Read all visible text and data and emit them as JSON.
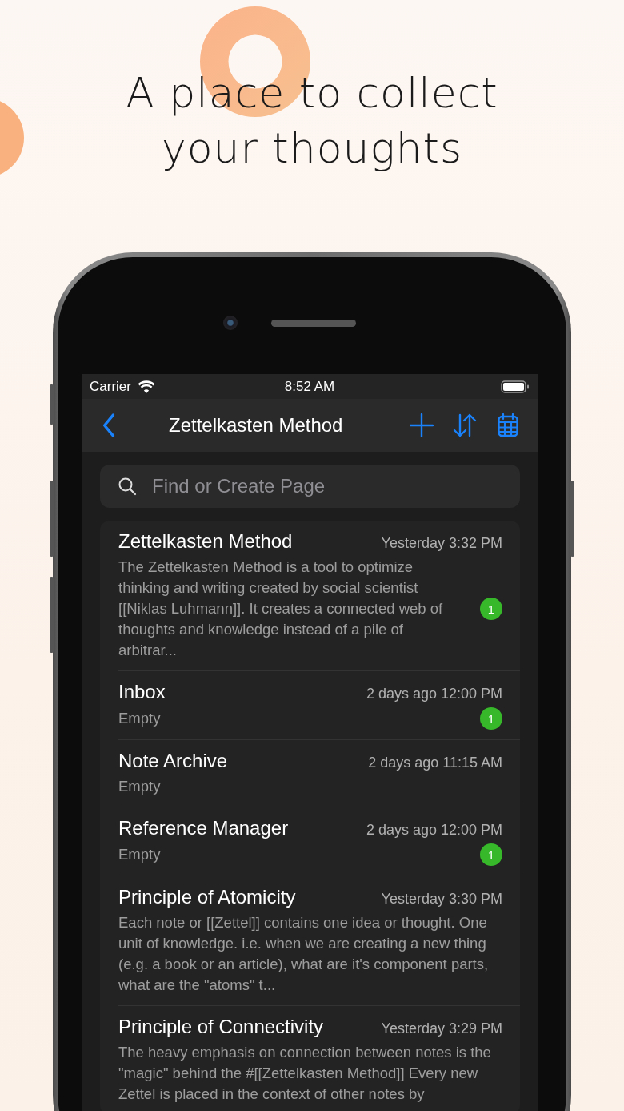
{
  "headline": "A place to collect your thoughts",
  "status_bar": {
    "carrier": "Carrier",
    "time": "8:52 AM"
  },
  "nav_bar": {
    "title": "Zettelkasten Method"
  },
  "search": {
    "placeholder": "Find or Create Page"
  },
  "notes": [
    {
      "title": "Zettelkasten Method",
      "time": "Yesterday 3:32 PM",
      "preview": "The Zettelkasten Method is a tool to optimize thinking and writing created by social scientist [[Niklas Luhmann]]. It creates a connected web of thoughts and knowledge instead of a pile of arbitrar...",
      "badge": "1"
    },
    {
      "title": "Inbox",
      "time": "2 days ago 12:00 PM",
      "preview": "Empty",
      "badge": "1"
    },
    {
      "title": "Note Archive",
      "time": "2 days ago 11:15 AM",
      "preview": "Empty"
    },
    {
      "title": "Reference Manager",
      "time": "2 days ago 12:00 PM",
      "preview": "Empty",
      "badge": "1"
    },
    {
      "title": "Principle of Atomicity",
      "time": "Yesterday 3:30 PM",
      "preview": "Each note or [[Zettel]] contains one idea or thought. One unit of knowledge. i.e. when we are creating a new thing (e.g. a book or an article), what are it's component parts, what are the \"atoms\" t..."
    },
    {
      "title": "Principle of Connectivity",
      "time": "Yesterday 3:29 PM",
      "preview": "The heavy emphasis on connection between notes is the \"magic\" behind the #[[Zettelkasten Method]] Every new Zettel is placed in the context of other notes by"
    }
  ]
}
